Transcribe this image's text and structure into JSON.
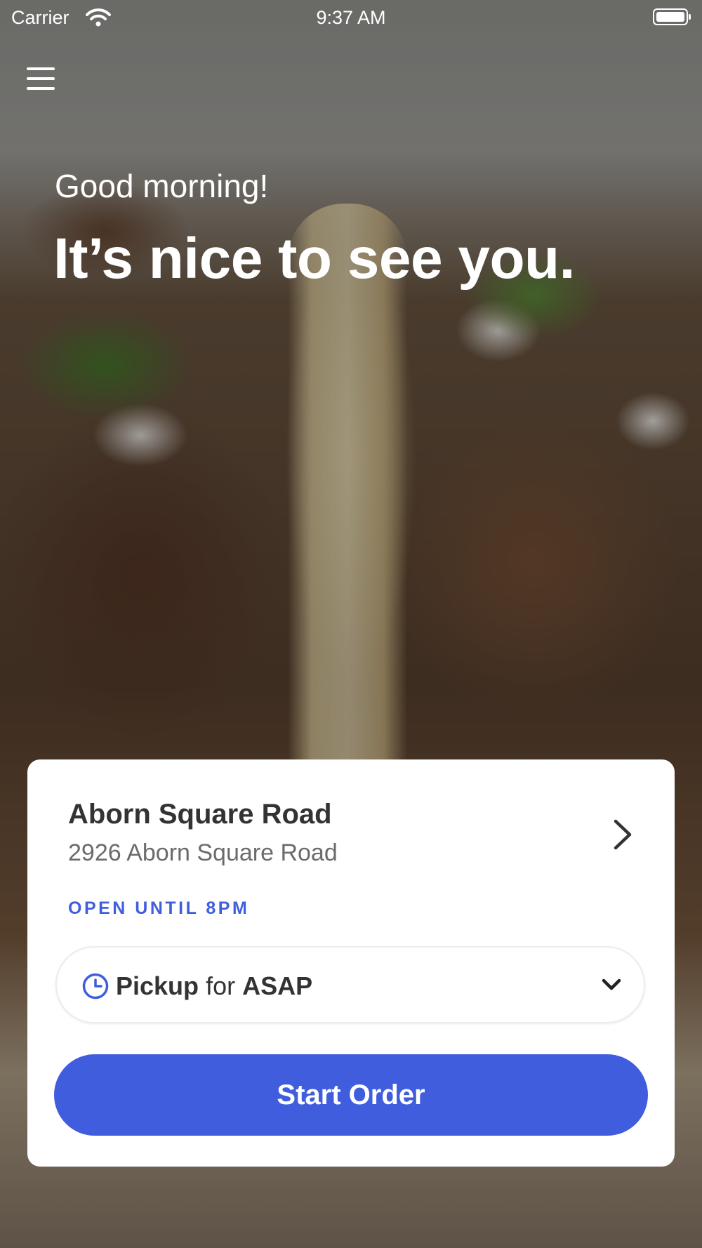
{
  "status_bar": {
    "carrier": "Carrier",
    "time": "9:37 AM"
  },
  "greeting": {
    "salutation": "Good morning!",
    "headline": "It’s nice to see you."
  },
  "store": {
    "name": "Aborn Square Road",
    "address": "2926 Aborn Square Road",
    "hours": "OPEN UNTIL 8PM"
  },
  "order_mode": {
    "method": "Pickup",
    "connector": "for",
    "time": "ASAP"
  },
  "actions": {
    "start_order": "Start Order"
  },
  "icons": {
    "menu": "hamburger-menu-icon",
    "store_chevron": "chevron-right-icon",
    "clock": "clock-icon",
    "caret": "chevron-down-icon"
  },
  "colors": {
    "accent": "#405ddd",
    "hours_text": "#3f5fdd"
  }
}
